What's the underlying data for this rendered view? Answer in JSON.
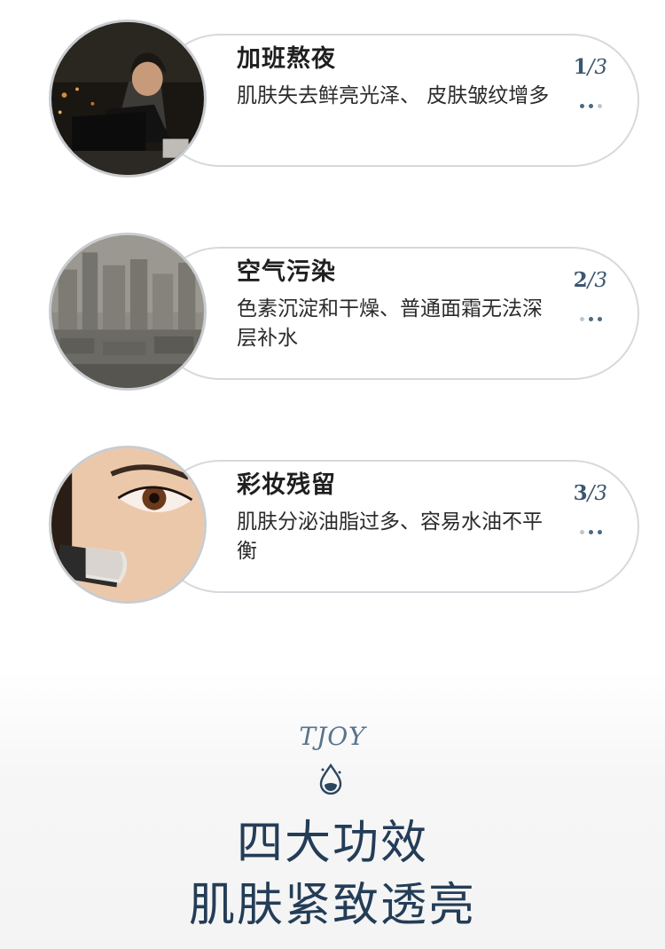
{
  "cards": [
    {
      "title": "加班熬夜",
      "desc": "肌肤失去鲜亮光泽、 皮肤皱纹增多",
      "index": "1",
      "total": "/3",
      "image": "person-working-late-at-night"
    },
    {
      "title": "空气污染",
      "desc": "色素沉淀和干燥、普通面霜无法深层补水",
      "index": "2",
      "total": "/3",
      "image": "hazy-city-skyline"
    },
    {
      "title": "彩妆残留",
      "desc": "肌肤分泌油脂过多、容易水油不平衡",
      "index": "3",
      "total": "/3",
      "image": "eye-with-makeup-brush"
    }
  ],
  "footer": {
    "brand": "TJOY",
    "headline_line1": "四大功效",
    "headline_line2": "肌肤紧致透亮",
    "icon": "water-drop-icon"
  },
  "colors": {
    "accent": "#3b5670",
    "headline": "#243d57",
    "pill_border": "#d6d9dc"
  }
}
